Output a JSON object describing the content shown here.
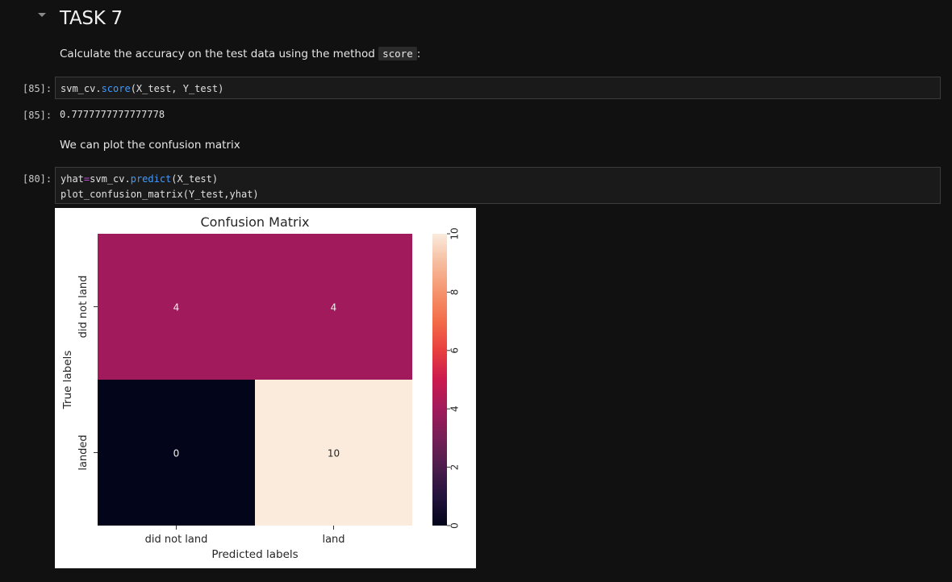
{
  "heading": "TASK 7",
  "md1": {
    "text": "Calculate the accuracy on the test data using the method ",
    "code": "score",
    "suffix": ":"
  },
  "cell1": {
    "prompt_in": "[85]:",
    "code": {
      "obj": "svm_cv.",
      "method": "score",
      "args": "(X_test, Y_test)"
    },
    "prompt_out": "[85]:",
    "output": "0.7777777777777778"
  },
  "md2": {
    "text": "We can plot the confusion matrix"
  },
  "cell2": {
    "prompt_in": "[80]:",
    "line1": {
      "lhs": "yhat",
      "op": "=",
      "obj": "svm_cv.",
      "method": "predict",
      "args": "(X_test)"
    },
    "line2": "plot_confusion_matrix(Y_test,yhat)"
  },
  "chart_data": {
    "type": "heatmap",
    "title": "Confusion Matrix",
    "xlabel": "Predicted labels",
    "ylabel": "True labels",
    "x_categories": [
      "did not land",
      "land"
    ],
    "y_categories": [
      "did not land",
      "landed"
    ],
    "values": [
      [
        4,
        4
      ],
      [
        0,
        10
      ]
    ],
    "colorbar": {
      "min": 0,
      "max": 10,
      "ticks": [
        0,
        2,
        4,
        6,
        8,
        10
      ],
      "colormap": "rocket"
    }
  }
}
